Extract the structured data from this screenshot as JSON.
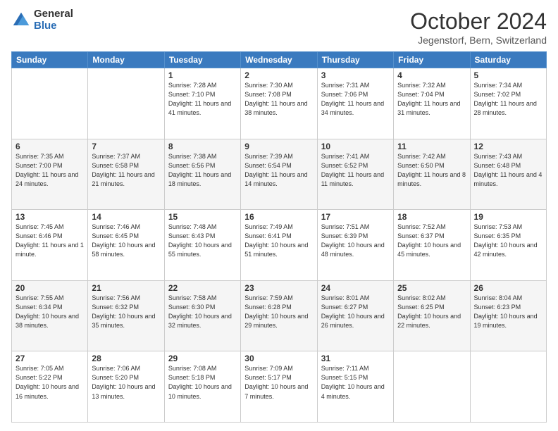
{
  "logo": {
    "general": "General",
    "blue": "Blue"
  },
  "header": {
    "month": "October 2024",
    "location": "Jegenstorf, Bern, Switzerland"
  },
  "weekdays": [
    "Sunday",
    "Monday",
    "Tuesday",
    "Wednesday",
    "Thursday",
    "Friday",
    "Saturday"
  ],
  "weeks": [
    [
      {
        "day": "",
        "info": ""
      },
      {
        "day": "",
        "info": ""
      },
      {
        "day": "1",
        "info": "Sunrise: 7:28 AM\nSunset: 7:10 PM\nDaylight: 11 hours and 41 minutes."
      },
      {
        "day": "2",
        "info": "Sunrise: 7:30 AM\nSunset: 7:08 PM\nDaylight: 11 hours and 38 minutes."
      },
      {
        "day": "3",
        "info": "Sunrise: 7:31 AM\nSunset: 7:06 PM\nDaylight: 11 hours and 34 minutes."
      },
      {
        "day": "4",
        "info": "Sunrise: 7:32 AM\nSunset: 7:04 PM\nDaylight: 11 hours and 31 minutes."
      },
      {
        "day": "5",
        "info": "Sunrise: 7:34 AM\nSunset: 7:02 PM\nDaylight: 11 hours and 28 minutes."
      }
    ],
    [
      {
        "day": "6",
        "info": "Sunrise: 7:35 AM\nSunset: 7:00 PM\nDaylight: 11 hours and 24 minutes."
      },
      {
        "day": "7",
        "info": "Sunrise: 7:37 AM\nSunset: 6:58 PM\nDaylight: 11 hours and 21 minutes."
      },
      {
        "day": "8",
        "info": "Sunrise: 7:38 AM\nSunset: 6:56 PM\nDaylight: 11 hours and 18 minutes."
      },
      {
        "day": "9",
        "info": "Sunrise: 7:39 AM\nSunset: 6:54 PM\nDaylight: 11 hours and 14 minutes."
      },
      {
        "day": "10",
        "info": "Sunrise: 7:41 AM\nSunset: 6:52 PM\nDaylight: 11 hours and 11 minutes."
      },
      {
        "day": "11",
        "info": "Sunrise: 7:42 AM\nSunset: 6:50 PM\nDaylight: 11 hours and 8 minutes."
      },
      {
        "day": "12",
        "info": "Sunrise: 7:43 AM\nSunset: 6:48 PM\nDaylight: 11 hours and 4 minutes."
      }
    ],
    [
      {
        "day": "13",
        "info": "Sunrise: 7:45 AM\nSunset: 6:46 PM\nDaylight: 11 hours and 1 minute."
      },
      {
        "day": "14",
        "info": "Sunrise: 7:46 AM\nSunset: 6:45 PM\nDaylight: 10 hours and 58 minutes."
      },
      {
        "day": "15",
        "info": "Sunrise: 7:48 AM\nSunset: 6:43 PM\nDaylight: 10 hours and 55 minutes."
      },
      {
        "day": "16",
        "info": "Sunrise: 7:49 AM\nSunset: 6:41 PM\nDaylight: 10 hours and 51 minutes."
      },
      {
        "day": "17",
        "info": "Sunrise: 7:51 AM\nSunset: 6:39 PM\nDaylight: 10 hours and 48 minutes."
      },
      {
        "day": "18",
        "info": "Sunrise: 7:52 AM\nSunset: 6:37 PM\nDaylight: 10 hours and 45 minutes."
      },
      {
        "day": "19",
        "info": "Sunrise: 7:53 AM\nSunset: 6:35 PM\nDaylight: 10 hours and 42 minutes."
      }
    ],
    [
      {
        "day": "20",
        "info": "Sunrise: 7:55 AM\nSunset: 6:34 PM\nDaylight: 10 hours and 38 minutes."
      },
      {
        "day": "21",
        "info": "Sunrise: 7:56 AM\nSunset: 6:32 PM\nDaylight: 10 hours and 35 minutes."
      },
      {
        "day": "22",
        "info": "Sunrise: 7:58 AM\nSunset: 6:30 PM\nDaylight: 10 hours and 32 minutes."
      },
      {
        "day": "23",
        "info": "Sunrise: 7:59 AM\nSunset: 6:28 PM\nDaylight: 10 hours and 29 minutes."
      },
      {
        "day": "24",
        "info": "Sunrise: 8:01 AM\nSunset: 6:27 PM\nDaylight: 10 hours and 26 minutes."
      },
      {
        "day": "25",
        "info": "Sunrise: 8:02 AM\nSunset: 6:25 PM\nDaylight: 10 hours and 22 minutes."
      },
      {
        "day": "26",
        "info": "Sunrise: 8:04 AM\nSunset: 6:23 PM\nDaylight: 10 hours and 19 minutes."
      }
    ],
    [
      {
        "day": "27",
        "info": "Sunrise: 7:05 AM\nSunset: 5:22 PM\nDaylight: 10 hours and 16 minutes."
      },
      {
        "day": "28",
        "info": "Sunrise: 7:06 AM\nSunset: 5:20 PM\nDaylight: 10 hours and 13 minutes."
      },
      {
        "day": "29",
        "info": "Sunrise: 7:08 AM\nSunset: 5:18 PM\nDaylight: 10 hours and 10 minutes."
      },
      {
        "day": "30",
        "info": "Sunrise: 7:09 AM\nSunset: 5:17 PM\nDaylight: 10 hours and 7 minutes."
      },
      {
        "day": "31",
        "info": "Sunrise: 7:11 AM\nSunset: 5:15 PM\nDaylight: 10 hours and 4 minutes."
      },
      {
        "day": "",
        "info": ""
      },
      {
        "day": "",
        "info": ""
      }
    ]
  ]
}
